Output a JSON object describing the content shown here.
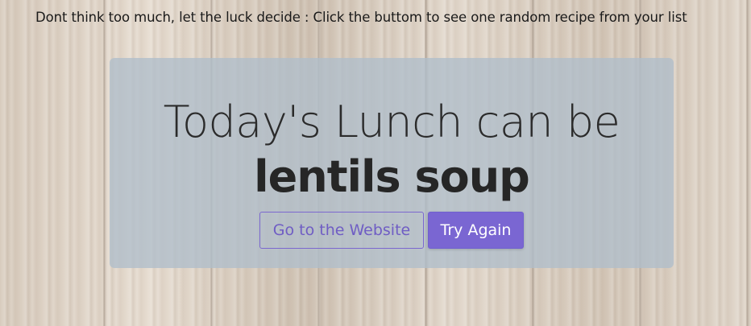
{
  "header": {
    "note": "Dont think too much, let the luck decide : Click the buttom to see one random recipe from your list"
  },
  "card": {
    "headline": "Today's Lunch can be",
    "dish": "lentils soup",
    "website_button": "Go to the Website",
    "try_again_button": "Try Again"
  },
  "colors": {
    "accent": "#7a66d2",
    "card_overlay": "#afbeca",
    "text_dark": "#262626"
  }
}
